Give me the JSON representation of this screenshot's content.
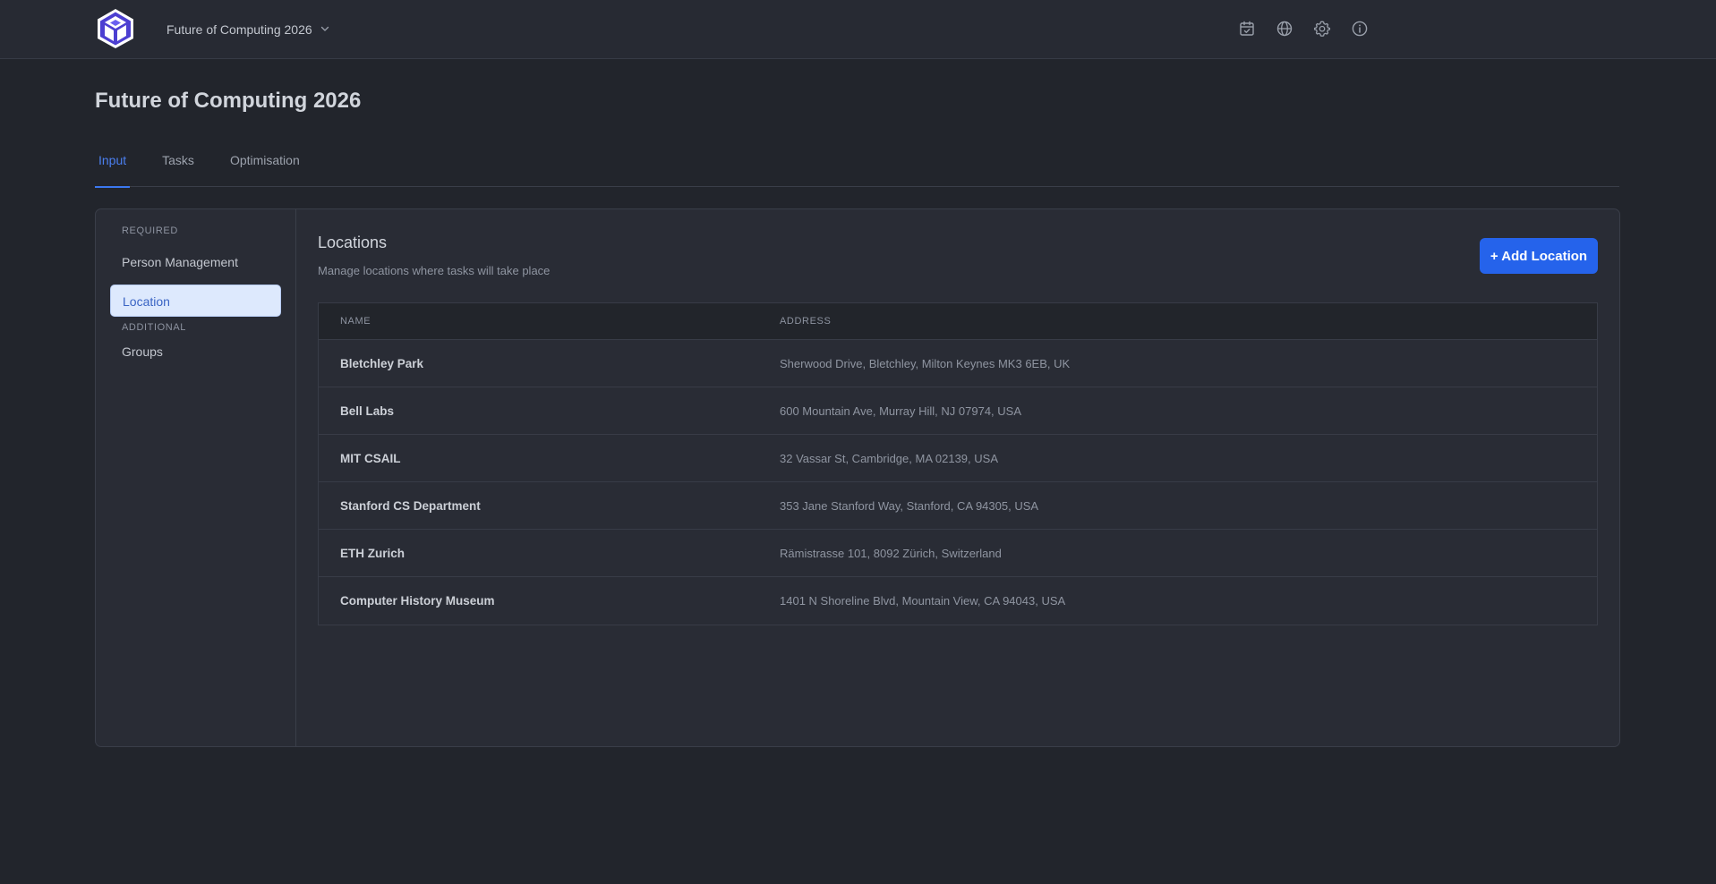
{
  "header": {
    "project_name": "Future of Computing 2026"
  },
  "page": {
    "title": "Future of Computing 2026"
  },
  "tabs": [
    {
      "label": "Input",
      "active": true
    },
    {
      "label": "Tasks",
      "active": false
    },
    {
      "label": "Optimisation",
      "active": false
    }
  ],
  "sidebar": {
    "required_label": "REQUIRED",
    "additional_label": "ADDITIONAL",
    "items": [
      {
        "label": "Person Management",
        "active": false
      },
      {
        "label": "Location",
        "active": true
      },
      {
        "label": "Groups",
        "active": false
      }
    ]
  },
  "content": {
    "title": "Locations",
    "subtitle": "Manage locations where tasks will take place",
    "add_button_label": "+ Add Location"
  },
  "table": {
    "columns": [
      "NAME",
      "ADDRESS"
    ],
    "rows": [
      {
        "name": "Bletchley Park",
        "address": "Sherwood Drive, Bletchley, Milton Keynes MK3 6EB, UK"
      },
      {
        "name": "Bell Labs",
        "address": "600 Mountain Ave, Murray Hill, NJ 07974, USA"
      },
      {
        "name": "MIT CSAIL",
        "address": "32 Vassar St, Cambridge, MA 02139, USA"
      },
      {
        "name": "Stanford CS Department",
        "address": "353 Jane Stanford Way, Stanford, CA 94305, USA"
      },
      {
        "name": "ETH Zurich",
        "address": "Rämistrasse 101, 8092 Zürich, Switzerland"
      },
      {
        "name": "Computer History Museum",
        "address": "1401 N Shoreline Blvd, Mountain View, CA 94043, USA"
      }
    ]
  },
  "icons": {
    "top_right": [
      "calendar-check-icon",
      "globe-icon",
      "gear-icon",
      "info-icon"
    ]
  },
  "colors": {
    "accent": "#2563eb",
    "active_tab": "#4b7ff0",
    "background": "#22252c",
    "panel": "#292c35"
  }
}
